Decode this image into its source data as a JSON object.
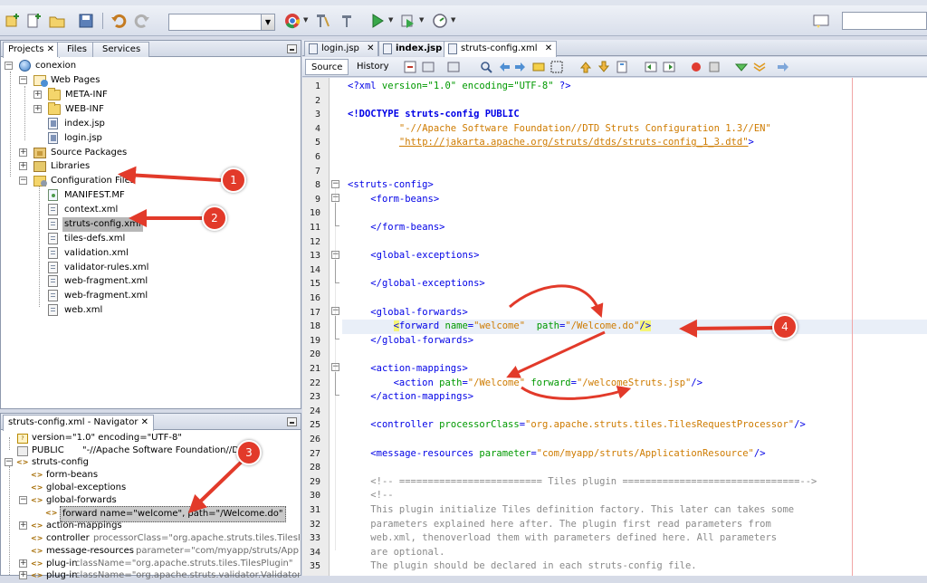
{
  "app": {
    "colors": {
      "accent_annotation": "#e23a2a",
      "xml_tag": "#0000e6",
      "xml_attr": "#009900",
      "xml_value": "#ce7b00",
      "comment": "#8a8a8a",
      "bracket_match": "#f5f577"
    }
  },
  "toolbar": {
    "icons": [
      "new-project-icon",
      "new-file-icon",
      "open-project-icon",
      "save-all-icon",
      "undo-icon",
      "redo-icon",
      "chrome-browser-icon",
      "clean-build-icon",
      "build-icon",
      "run-icon",
      "debug-icon",
      "profile-icon"
    ],
    "config_combo_value": "",
    "search_placeholder": ""
  },
  "projects_panel": {
    "tabs": [
      {
        "label": "Projects",
        "close": "✕"
      },
      {
        "label": "Files"
      },
      {
        "label": "Services"
      }
    ],
    "tree": [
      {
        "label": "conexion",
        "icon": "project-icon"
      },
      {
        "label": "Web Pages",
        "icon": "web-folder-icon"
      },
      {
        "label": "META-INF",
        "icon": "folder-icon"
      },
      {
        "label": "WEB-INF",
        "icon": "folder-icon"
      },
      {
        "label": "index.jsp",
        "icon": "jsp-file-icon"
      },
      {
        "label": "login.jsp",
        "icon": "jsp-file-icon"
      },
      {
        "label": "Source Packages",
        "icon": "package-folder-icon"
      },
      {
        "label": "Libraries",
        "icon": "library-icon"
      },
      {
        "label": "Configuration Files",
        "icon": "config-folder-icon"
      },
      {
        "label": "MANIFEST.MF",
        "icon": "manifest-icon"
      },
      {
        "label": "context.xml",
        "icon": "xml-file-icon"
      },
      {
        "label": "struts-config.xml",
        "icon": "xml-file-icon",
        "selected": true
      },
      {
        "label": "tiles-defs.xml",
        "icon": "xml-file-icon"
      },
      {
        "label": "validation.xml",
        "icon": "xml-file-icon"
      },
      {
        "label": "validator-rules.xml",
        "icon": "xml-file-icon"
      },
      {
        "label": "web-fragment.xml",
        "icon": "xml-file-icon"
      },
      {
        "label": "web-fragment.xml",
        "icon": "xml-file-icon"
      },
      {
        "label": "web.xml",
        "icon": "xml-file-icon"
      }
    ]
  },
  "navigator_panel": {
    "title": "struts-config.xml - Navigator",
    "close": "✕",
    "tree": [
      {
        "label": "version=\"1.0\" encoding=\"UTF-8\"",
        "icon": "xml-declaration-icon"
      },
      {
        "label": "PUBLIC",
        "extra": "\"-//Apache Software Foundation//D...",
        "icon": "doctype-icon"
      },
      {
        "label": "struts-config",
        "icon": "xml-element-icon"
      },
      {
        "label": "form-beans",
        "icon": "xml-element-icon"
      },
      {
        "label": "global-exceptions",
        "icon": "xml-element-icon"
      },
      {
        "label": "global-forwards",
        "icon": "xml-element-icon"
      },
      {
        "label": "forward name=\"welcome\", path=\"/Welcome.do\"",
        "icon": "xml-element-icon",
        "selected": true
      },
      {
        "label": "action-mappings",
        "icon": "xml-element-icon"
      },
      {
        "label": "controller",
        "extra": "processorClass=\"org.apache.struts.tiles.TilesRequestPro",
        "icon": "xml-element-icon"
      },
      {
        "label": "message-resources",
        "extra": "parameter=\"com/myapp/struts/ApplicationRes",
        "icon": "xml-element-icon"
      },
      {
        "label": "plug-in",
        "extra": "className=\"org.apache.struts.tiles.TilesPlugin\"",
        "icon": "xml-element-icon"
      },
      {
        "label": "plug-in",
        "extra": "className=\"org.apache.struts.validator.ValidatorPlugIn\"",
        "icon": "xml-element-icon"
      }
    ]
  },
  "editor": {
    "tabs": [
      {
        "label": "login.jsp",
        "close": "✕"
      },
      {
        "label": "index.jsp",
        "close": "✕",
        "bold": true
      },
      {
        "label": "struts-config.xml",
        "close": "✕",
        "active": true
      }
    ],
    "modes": [
      "Source",
      "History"
    ],
    "lines": [
      {
        "n": "1"
      },
      {
        "n": "2"
      },
      {
        "n": "3"
      },
      {
        "n": "4"
      },
      {
        "n": "5"
      },
      {
        "n": "6"
      },
      {
        "n": "7"
      },
      {
        "n": "8"
      },
      {
        "n": "9"
      },
      {
        "n": "10"
      },
      {
        "n": "11"
      },
      {
        "n": "12"
      },
      {
        "n": "13"
      },
      {
        "n": "14"
      },
      {
        "n": "15"
      },
      {
        "n": "16"
      },
      {
        "n": "17"
      },
      {
        "n": "18"
      },
      {
        "n": "19"
      },
      {
        "n": "20"
      },
      {
        "n": "21"
      },
      {
        "n": "22"
      },
      {
        "n": "23"
      },
      {
        "n": "24"
      },
      {
        "n": "25"
      },
      {
        "n": "26"
      },
      {
        "n": "27"
      },
      {
        "n": "28"
      },
      {
        "n": "29"
      },
      {
        "n": "30"
      },
      {
        "n": "31"
      },
      {
        "n": "32"
      },
      {
        "n": "33"
      },
      {
        "n": "34"
      },
      {
        "n": "35"
      }
    ],
    "code": {
      "l1_tag": "<?xml",
      "l1_attrs": " version=\"1.0\" encoding=\"UTF-8\" ",
      "l1_end": "?>",
      "l3": "<!DOCTYPE struts-config PUBLIC",
      "l4": "\"-//Apache Software Foundation//DTD Struts Configuration 1.3//EN\"",
      "l5_link": "\"http://jakarta.apache.org/struts/dtds/struts-config_1_3.dtd\"",
      "l5_end": ">",
      "l8": "<struts-config>",
      "l9": "<form-beans>",
      "l11": "</form-beans>",
      "l13": "<global-exceptions>",
      "l15": "</global-exceptions>",
      "l17": "<global-forwards>",
      "l18_open": "<",
      "l18_tag": "forward",
      "l18_a1": "name",
      "l18_v1": "\"welcome\"",
      "l18_a2": "path",
      "l18_v2": "\"/Welcome.do\"",
      "l18_slash": "/",
      "l18_close": ">",
      "l19": "</global-forwards>",
      "l21": "<action-mappings>",
      "l22_tag": "<action",
      "l22_a1": "path",
      "l22_v1": "\"/Welcome\"",
      "l22_a2": "forward",
      "l22_v2": "\"/welcomeStruts.jsp\"",
      "l22_end": "/>",
      "l23": "</action-mappings>",
      "l25_tag": "<controller",
      "l25_a": "processorClass",
      "l25_v": "\"org.apache.struts.tiles.TilesRequestProcessor\"",
      "l25_end": "/>",
      "l27_tag": "<message-resources",
      "l27_a": "parameter",
      "l27_v": "\"com/myapp/struts/ApplicationResource\"",
      "l27_end": "/>",
      "l29": "<!-- ========================= Tiles plugin ===============================-->",
      "l30": "<!--",
      "l31": "This plugin initialize Tiles definition factory. This later can takes some",
      "l32": "parameters explained here after. The plugin first read parameters from",
      "l33": "web.xml, thenoverload them with parameters defined here. All parameters",
      "l34": "are optional.",
      "l35": "The plugin should be declared in each struts-config file."
    }
  },
  "annotations": {
    "badges": [
      "1",
      "2",
      "3",
      "4"
    ]
  }
}
